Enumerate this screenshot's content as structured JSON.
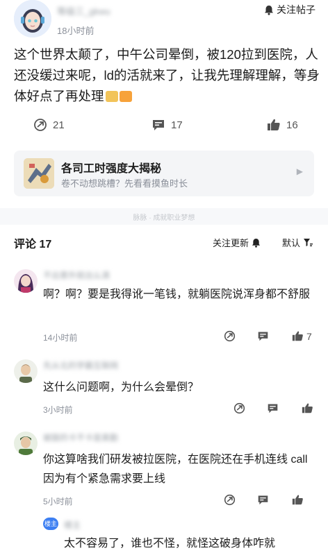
{
  "post": {
    "author_nick": "等级三_gkwu",
    "time": "18小时前",
    "follow_label": "关注帖子",
    "body": "这个世界太颠了，中午公司晕倒，被120拉到医院，人还没缓过来呢，ld的活就来了，让我先理解理解，等身体好点了再处理",
    "emoji_colors": [
      "#f2c45a",
      "#f7a23a"
    ],
    "stats": {
      "shares": "21",
      "comments": "17",
      "likes": "16"
    }
  },
  "card": {
    "title": "各司工时强度大揭秘",
    "subtitle": "卷不动想跳槽？先看看摸鱼时长"
  },
  "footer_note": "脉脉 · 成就职业梦想",
  "comments_header": {
    "title": "评论 17",
    "follow_update": "关注更新",
    "sort": "默认"
  },
  "comments": [
    {
      "nick": "不出意外就出么滴",
      "text": "啊？啊？要是我得讹一笔钱，就躺医院说浑身都不舒服",
      "time": "14小时前",
      "likes": "7"
    },
    {
      "nick": "先从北的学霸互联网",
      "text": "这什么问题啊，为什么会晕倒？",
      "time": "3小时前",
      "likes": ""
    },
    {
      "nick": "被鼓的卡不卡是奥勤",
      "text": "你这算啥我们研发被拉医院，在医院还在手机连线 call 因为有个紧急需求要上线",
      "time": "5小时前",
      "likes": ""
    }
  ],
  "reply": {
    "badge": "楼主",
    "nick": "楼主",
    "text": "太不容易了，谁也不怪，就怪这破身体咋就"
  },
  "colors": {
    "accent_blue": "#3d7ff2",
    "text_main": "#1d1d1d",
    "text_muted": "#8a8f99"
  }
}
